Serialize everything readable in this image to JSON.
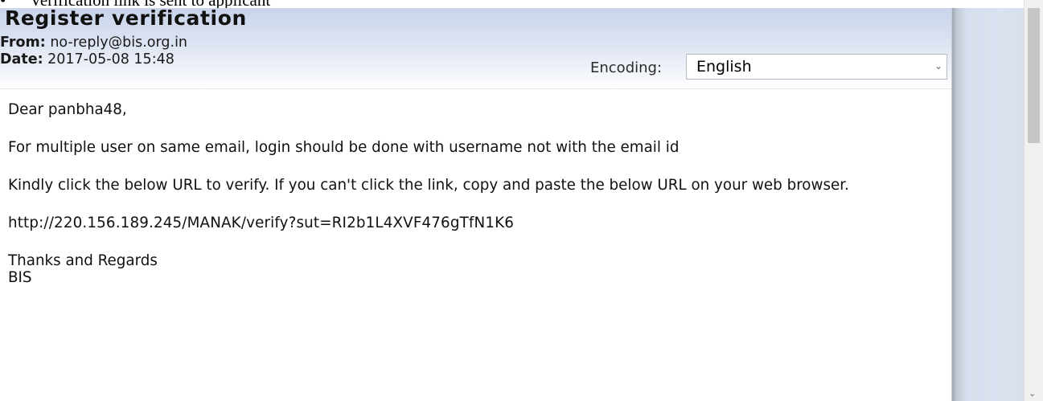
{
  "doc_caption": {
    "bullet": "•",
    "text": "Verification link is sent to applicant"
  },
  "mail": {
    "subject": "Register verification",
    "from_key": "From:",
    "from_value": "no-reply@bis.org.in",
    "date_key": "Date:",
    "date_value": "2017-05-08 15:48",
    "encoding_label": "Encoding:",
    "encoding_value": "English",
    "chevron_icon": "chevron-down-icon",
    "body": {
      "greeting": "Dear panbha48,",
      "para1": "For multiple user on same email, login should be done with username not with the email id",
      "para2": "Kindly click the below URL to verify. If you can't click the link, copy and paste the below URL on your web browser.",
      "url": "http://220.156.189.245/MANAK/verify?sut=RI2b1L4XVF476gTfN1K6",
      "sign1": "Thanks and Regards",
      "sign2": "BIS"
    }
  },
  "scrollbar": {
    "down_icon": "chevron-down-icon"
  }
}
